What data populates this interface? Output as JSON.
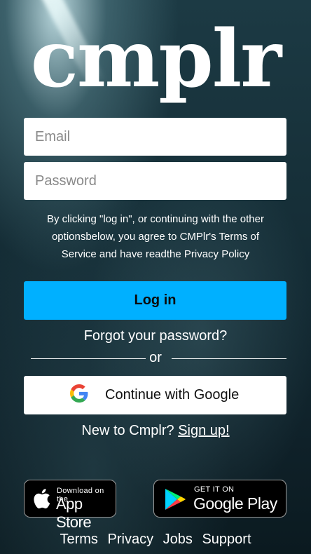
{
  "logo": {
    "text": "cmplr"
  },
  "form": {
    "email_placeholder": "Email",
    "password_placeholder": "Password",
    "disclaimer": "By clicking \"log in\", or continuing with the other optionsbelow, you agree to CMPlr's Terms of Service and have readthe Privacy Policy",
    "login_label": "Log in",
    "forgot_label": "Forgot your password?",
    "or_label": "or",
    "google_label": "Continue with Google"
  },
  "signup": {
    "prompt": "New to Cmplr?",
    "link": "Sign up!"
  },
  "badges": {
    "appstore": {
      "small": "Download on the",
      "big": "App Store",
      "icon": "apple-icon"
    },
    "googleplay": {
      "small": "GET IT ON",
      "big": "Google Play",
      "icon": "google-play-icon"
    }
  },
  "footer": {
    "links": [
      "Terms",
      "Privacy",
      "Jobs",
      "Support"
    ]
  },
  "colors": {
    "accent": "#00b0ff",
    "text": "#ffffff"
  }
}
